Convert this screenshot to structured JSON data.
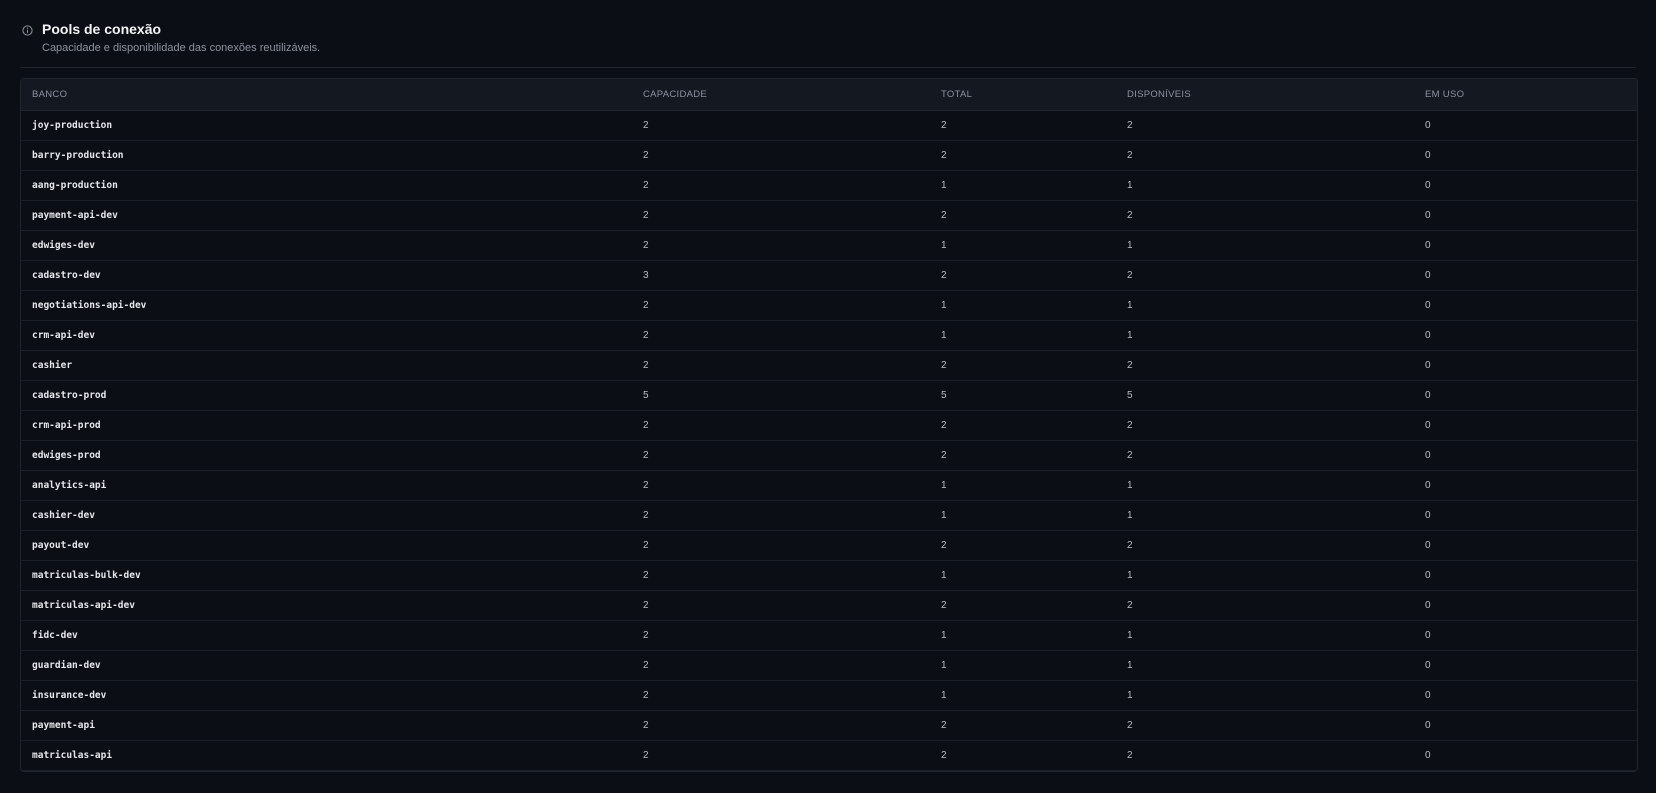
{
  "header": {
    "title": "Pools de conexão",
    "subtitle": "Capacidade e disponibilidade das conexões reutilizáveis.",
    "icon": "info-icon"
  },
  "table": {
    "columns": [
      "BANCO",
      "CAPACIDADE",
      "TOTAL",
      "DISPONÍVEIS",
      "EM USO"
    ],
    "rows": [
      [
        "joy-production",
        "2",
        "2",
        "2",
        "0"
      ],
      [
        "barry-production",
        "2",
        "2",
        "2",
        "0"
      ],
      [
        "aang-production",
        "2",
        "1",
        "1",
        "0"
      ],
      [
        "payment-api-dev",
        "2",
        "2",
        "2",
        "0"
      ],
      [
        "edwiges-dev",
        "2",
        "1",
        "1",
        "0"
      ],
      [
        "cadastro-dev",
        "3",
        "2",
        "2",
        "0"
      ],
      [
        "negotiations-api-dev",
        "2",
        "1",
        "1",
        "0"
      ],
      [
        "crm-api-dev",
        "2",
        "1",
        "1",
        "0"
      ],
      [
        "cashier",
        "2",
        "2",
        "2",
        "0"
      ],
      [
        "cadastro-prod",
        "5",
        "5",
        "5",
        "0"
      ],
      [
        "crm-api-prod",
        "2",
        "2",
        "2",
        "0"
      ],
      [
        "edwiges-prod",
        "2",
        "2",
        "2",
        "0"
      ],
      [
        "analytics-api",
        "2",
        "1",
        "1",
        "0"
      ],
      [
        "cashier-dev",
        "2",
        "1",
        "1",
        "0"
      ],
      [
        "payout-dev",
        "2",
        "2",
        "2",
        "0"
      ],
      [
        "matriculas-bulk-dev",
        "2",
        "1",
        "1",
        "0"
      ],
      [
        "matriculas-api-dev",
        "2",
        "2",
        "2",
        "0"
      ],
      [
        "fidc-dev",
        "2",
        "1",
        "1",
        "0"
      ],
      [
        "guardian-dev",
        "2",
        "1",
        "1",
        "0"
      ],
      [
        "insurance-dev",
        "2",
        "1",
        "1",
        "0"
      ],
      [
        "payment-api",
        "2",
        "2",
        "2",
        "0"
      ],
      [
        "matriculas-api",
        "2",
        "2",
        "2",
        "0"
      ]
    ]
  },
  "colors": {
    "background": "#0b0e14",
    "header_row": "#131821",
    "border": "#1f2630",
    "text": "#b8bec8"
  }
}
